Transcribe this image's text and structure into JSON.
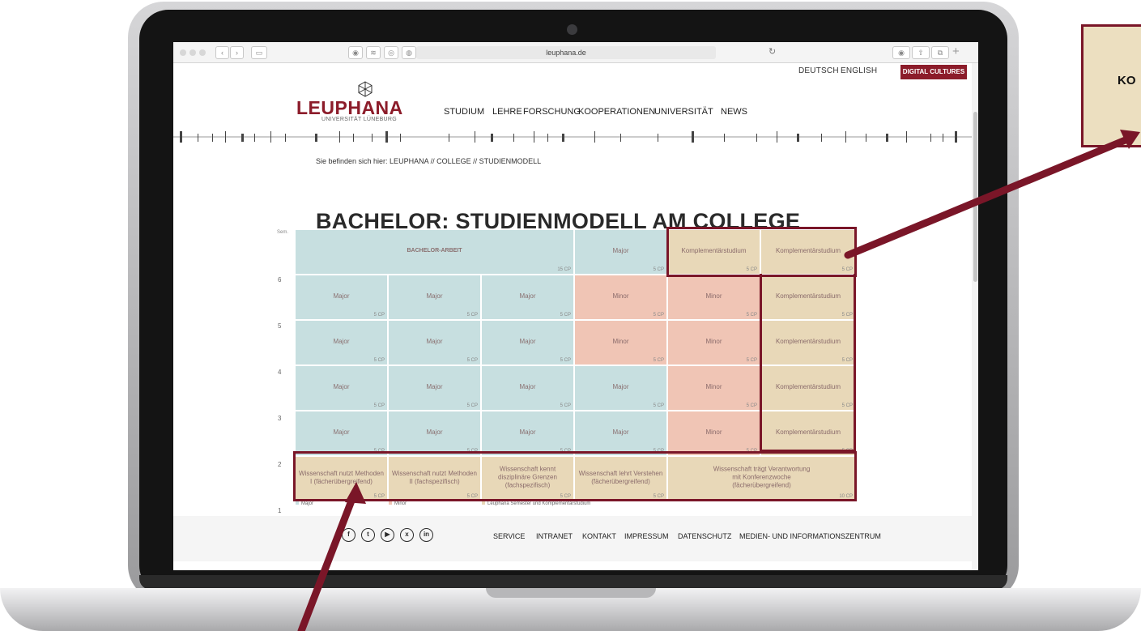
{
  "browser": {
    "address": "leuphana.de",
    "back_icon": "chevron-left-icon",
    "forward_icon": "chevron-right-icon"
  },
  "header": {
    "lang_de": "DEUTSCH",
    "lang_en": "ENGLISH",
    "digital_cultures": "DIGITAL CULTURES",
    "logo": "LEUPHANA",
    "logo_sub": "UNIVERSITÄT LÜNEBURG",
    "nav": [
      "STUDIUM",
      "LEHRE",
      "FORSCHUNG",
      "KOOPERATIONEN",
      "UNIVERSITÄT",
      "NEWS"
    ]
  },
  "breadcrumb": "Sie befinden sich hier: LEUPHANA // COLLEGE // STUDIENMODELL",
  "page_title": "BACHELOR: STUDIENMODELL AM COLLEGE",
  "grid": {
    "sem_label": "Sem.",
    "row_labels": [
      "6",
      "5",
      "4",
      "3",
      "2",
      "1"
    ],
    "bachelor_arbeit": "BACHELOR-ARBEIT",
    "bachelor_cp": "15 CP",
    "major": "Major",
    "minor": "Minor",
    "komplementaer": "Komplementärstudium",
    "cp5": "5 CP",
    "cp10": "10 CP",
    "row1": [
      "Wissenschaft nutzt Methoden I (fächerübergreifend)",
      "Wissenschaft nutzt Methoden II (fachspezifisch)",
      "Wissenschaft kennt disziplinäre Grenzen (fachspezifisch)",
      "Wissenschaft lehrt Verstehen (fächerübergreifend)",
      "Wissenschaft trägt Verantwortung mit Konferenzwoche (fächerübergreifend)"
    ]
  },
  "legend": {
    "major": "Major",
    "minor": "Minor",
    "leuphana": "Leuphana Semester und Komplementärstudium"
  },
  "footer": {
    "social_icons": [
      "facebook-icon",
      "twitter-icon",
      "youtube-icon",
      "xing-icon",
      "linkedin-icon"
    ],
    "links": [
      "SERVICE",
      "INTRANET",
      "KONTAKT",
      "IMPRESSUM",
      "DATENSCHUTZ",
      "MEDIEN- UND INFORMATIONSZENTRUM"
    ]
  },
  "callout": {
    "text": "KO"
  },
  "colors": {
    "brand": "#8c1c2a",
    "major": "#c7dfe0",
    "minor": "#f0c5b5",
    "komplementaer": "#e8d8b8",
    "highlight": "#7a1628"
  }
}
